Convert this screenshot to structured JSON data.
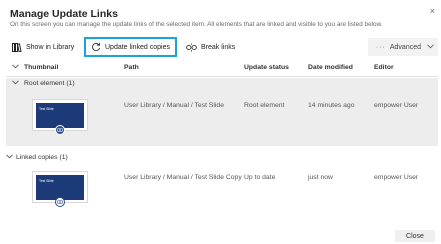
{
  "dialog": {
    "title": "Manage Update Links",
    "subtitle": "On this screen you can manage the update links of the selected item. All elements that are linked and visible to you are listed below.",
    "close_glyph": "×"
  },
  "toolbar": {
    "show_in_library": "Show in Library",
    "update_linked_copies": "Update linked copies",
    "break_links": "Break links",
    "advanced": "Advanced",
    "advanced_dots": "···"
  },
  "table": {
    "columns": {
      "thumbnail": "Thumbnail",
      "path": "Path",
      "update_status": "Update status",
      "date_modified": "Date modified",
      "editor": "Editor"
    },
    "groups": [
      {
        "label": "Root element (1)",
        "rows": [
          {
            "slide_title": "Test Slide",
            "path": "User Library / Manual / Test Slide",
            "update_status": "Root element",
            "date_modified": "14 minutes ago",
            "editor": "empower User"
          }
        ]
      },
      {
        "label": "Linked copies (1)",
        "rows": [
          {
            "slide_title": "Test Slide",
            "path": "User Library / Manual / Test Slide Copy",
            "update_status": "Up to date",
            "date_modified": "just now",
            "editor": "empower User"
          }
        ]
      }
    ]
  },
  "footer": {
    "close": "Close"
  },
  "colors": {
    "highlight": "#1aa5d6",
    "slide_bg": "#1c3a78",
    "row_selected": "#ededed"
  }
}
